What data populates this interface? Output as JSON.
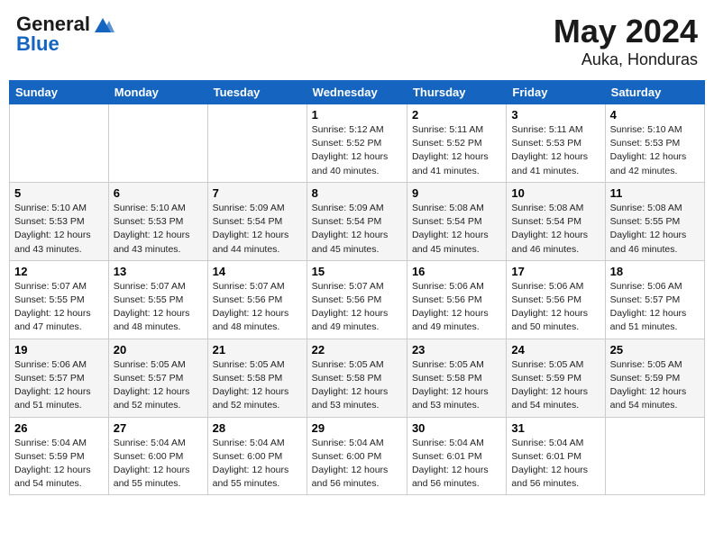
{
  "header": {
    "logo_line1": "General",
    "logo_line2": "Blue",
    "month": "May 2024",
    "location": "Auka, Honduras"
  },
  "weekdays": [
    "Sunday",
    "Monday",
    "Tuesday",
    "Wednesday",
    "Thursday",
    "Friday",
    "Saturday"
  ],
  "weeks": [
    [
      {
        "day": "",
        "sunrise": "",
        "sunset": "",
        "daylight": ""
      },
      {
        "day": "",
        "sunrise": "",
        "sunset": "",
        "daylight": ""
      },
      {
        "day": "",
        "sunrise": "",
        "sunset": "",
        "daylight": ""
      },
      {
        "day": "1",
        "sunrise": "Sunrise: 5:12 AM",
        "sunset": "Sunset: 5:52 PM",
        "daylight": "Daylight: 12 hours and 40 minutes."
      },
      {
        "day": "2",
        "sunrise": "Sunrise: 5:11 AM",
        "sunset": "Sunset: 5:52 PM",
        "daylight": "Daylight: 12 hours and 41 minutes."
      },
      {
        "day": "3",
        "sunrise": "Sunrise: 5:11 AM",
        "sunset": "Sunset: 5:53 PM",
        "daylight": "Daylight: 12 hours and 41 minutes."
      },
      {
        "day": "4",
        "sunrise": "Sunrise: 5:10 AM",
        "sunset": "Sunset: 5:53 PM",
        "daylight": "Daylight: 12 hours and 42 minutes."
      }
    ],
    [
      {
        "day": "5",
        "sunrise": "Sunrise: 5:10 AM",
        "sunset": "Sunset: 5:53 PM",
        "daylight": "Daylight: 12 hours and 43 minutes."
      },
      {
        "day": "6",
        "sunrise": "Sunrise: 5:10 AM",
        "sunset": "Sunset: 5:53 PM",
        "daylight": "Daylight: 12 hours and 43 minutes."
      },
      {
        "day": "7",
        "sunrise": "Sunrise: 5:09 AM",
        "sunset": "Sunset: 5:54 PM",
        "daylight": "Daylight: 12 hours and 44 minutes."
      },
      {
        "day": "8",
        "sunrise": "Sunrise: 5:09 AM",
        "sunset": "Sunset: 5:54 PM",
        "daylight": "Daylight: 12 hours and 45 minutes."
      },
      {
        "day": "9",
        "sunrise": "Sunrise: 5:08 AM",
        "sunset": "Sunset: 5:54 PM",
        "daylight": "Daylight: 12 hours and 45 minutes."
      },
      {
        "day": "10",
        "sunrise": "Sunrise: 5:08 AM",
        "sunset": "Sunset: 5:54 PM",
        "daylight": "Daylight: 12 hours and 46 minutes."
      },
      {
        "day": "11",
        "sunrise": "Sunrise: 5:08 AM",
        "sunset": "Sunset: 5:55 PM",
        "daylight": "Daylight: 12 hours and 46 minutes."
      }
    ],
    [
      {
        "day": "12",
        "sunrise": "Sunrise: 5:07 AM",
        "sunset": "Sunset: 5:55 PM",
        "daylight": "Daylight: 12 hours and 47 minutes."
      },
      {
        "day": "13",
        "sunrise": "Sunrise: 5:07 AM",
        "sunset": "Sunset: 5:55 PM",
        "daylight": "Daylight: 12 hours and 48 minutes."
      },
      {
        "day": "14",
        "sunrise": "Sunrise: 5:07 AM",
        "sunset": "Sunset: 5:56 PM",
        "daylight": "Daylight: 12 hours and 48 minutes."
      },
      {
        "day": "15",
        "sunrise": "Sunrise: 5:07 AM",
        "sunset": "Sunset: 5:56 PM",
        "daylight": "Daylight: 12 hours and 49 minutes."
      },
      {
        "day": "16",
        "sunrise": "Sunrise: 5:06 AM",
        "sunset": "Sunset: 5:56 PM",
        "daylight": "Daylight: 12 hours and 49 minutes."
      },
      {
        "day": "17",
        "sunrise": "Sunrise: 5:06 AM",
        "sunset": "Sunset: 5:56 PM",
        "daylight": "Daylight: 12 hours and 50 minutes."
      },
      {
        "day": "18",
        "sunrise": "Sunrise: 5:06 AM",
        "sunset": "Sunset: 5:57 PM",
        "daylight": "Daylight: 12 hours and 51 minutes."
      }
    ],
    [
      {
        "day": "19",
        "sunrise": "Sunrise: 5:06 AM",
        "sunset": "Sunset: 5:57 PM",
        "daylight": "Daylight: 12 hours and 51 minutes."
      },
      {
        "day": "20",
        "sunrise": "Sunrise: 5:05 AM",
        "sunset": "Sunset: 5:57 PM",
        "daylight": "Daylight: 12 hours and 52 minutes."
      },
      {
        "day": "21",
        "sunrise": "Sunrise: 5:05 AM",
        "sunset": "Sunset: 5:58 PM",
        "daylight": "Daylight: 12 hours and 52 minutes."
      },
      {
        "day": "22",
        "sunrise": "Sunrise: 5:05 AM",
        "sunset": "Sunset: 5:58 PM",
        "daylight": "Daylight: 12 hours and 53 minutes."
      },
      {
        "day": "23",
        "sunrise": "Sunrise: 5:05 AM",
        "sunset": "Sunset: 5:58 PM",
        "daylight": "Daylight: 12 hours and 53 minutes."
      },
      {
        "day": "24",
        "sunrise": "Sunrise: 5:05 AM",
        "sunset": "Sunset: 5:59 PM",
        "daylight": "Daylight: 12 hours and 54 minutes."
      },
      {
        "day": "25",
        "sunrise": "Sunrise: 5:05 AM",
        "sunset": "Sunset: 5:59 PM",
        "daylight": "Daylight: 12 hours and 54 minutes."
      }
    ],
    [
      {
        "day": "26",
        "sunrise": "Sunrise: 5:04 AM",
        "sunset": "Sunset: 5:59 PM",
        "daylight": "Daylight: 12 hours and 54 minutes."
      },
      {
        "day": "27",
        "sunrise": "Sunrise: 5:04 AM",
        "sunset": "Sunset: 6:00 PM",
        "daylight": "Daylight: 12 hours and 55 minutes."
      },
      {
        "day": "28",
        "sunrise": "Sunrise: 5:04 AM",
        "sunset": "Sunset: 6:00 PM",
        "daylight": "Daylight: 12 hours and 55 minutes."
      },
      {
        "day": "29",
        "sunrise": "Sunrise: 5:04 AM",
        "sunset": "Sunset: 6:00 PM",
        "daylight": "Daylight: 12 hours and 56 minutes."
      },
      {
        "day": "30",
        "sunrise": "Sunrise: 5:04 AM",
        "sunset": "Sunset: 6:01 PM",
        "daylight": "Daylight: 12 hours and 56 minutes."
      },
      {
        "day": "31",
        "sunrise": "Sunrise: 5:04 AM",
        "sunset": "Sunset: 6:01 PM",
        "daylight": "Daylight: 12 hours and 56 minutes."
      },
      {
        "day": "",
        "sunrise": "",
        "sunset": "",
        "daylight": ""
      }
    ]
  ]
}
